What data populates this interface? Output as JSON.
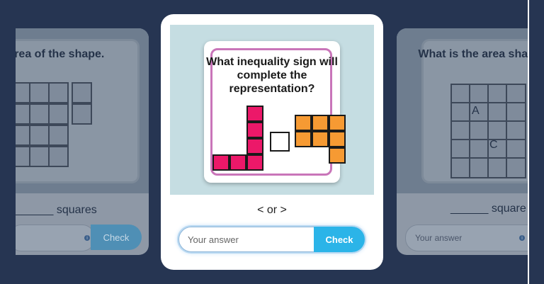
{
  "left_card": {
    "question": "d the area of the shape.",
    "answer_suffix": "______ squares",
    "check_label": "Check",
    "info_icon": "info-icon"
  },
  "main_card": {
    "question": "What inequality sign will complete the representation?",
    "prompt": "< or >",
    "answer_placeholder": "Your answer",
    "check_label": "Check",
    "colors": {
      "pink": "#ec1869",
      "orange": "#f69a33",
      "frame": "#c975b9",
      "check": "#2bb4e8"
    }
  },
  "right_card": {
    "question": "What is the area shape C?",
    "letters": [
      "A",
      "C"
    ],
    "answer_suffix": "______ square",
    "answer_placeholder": "Your answer",
    "info_icon": "info-icon"
  }
}
